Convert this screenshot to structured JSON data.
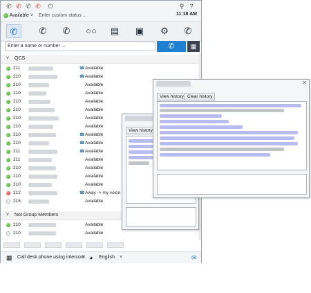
{
  "header": {
    "status_label": "Available",
    "custom_status_placeholder": "Enter custom status ...",
    "time": "11:18 AM"
  },
  "search": {
    "placeholder": "Enter a name or number ..."
  },
  "groups": [
    {
      "name": "QCS"
    },
    {
      "name": "Not Group Members"
    }
  ],
  "qcs_rows": [
    {
      "ext": "211",
      "status": "Available",
      "state": "green",
      "phone": true
    },
    {
      "ext": "210",
      "status": "Available",
      "state": "green",
      "phone": true
    },
    {
      "ext": "210",
      "status": "Available",
      "state": "green",
      "phone": false
    },
    {
      "ext": "210",
      "status": "Available",
      "state": "green",
      "phone": false
    },
    {
      "ext": "210",
      "status": "Available",
      "state": "green",
      "phone": false
    },
    {
      "ext": "210",
      "status": "Available",
      "state": "green",
      "phone": false
    },
    {
      "ext": "210",
      "status": "Available",
      "state": "green",
      "phone": false
    },
    {
      "ext": "210",
      "status": "Available",
      "state": "green",
      "phone": false
    },
    {
      "ext": "210",
      "status": "Available",
      "state": "green",
      "phone": true
    },
    {
      "ext": "210",
      "status": "Available",
      "state": "green",
      "phone": true
    },
    {
      "ext": "211",
      "status": "Available",
      "state": "green",
      "phone": true
    },
    {
      "ext": "211",
      "status": "Available",
      "state": "green",
      "phone": false
    },
    {
      "ext": "210",
      "status": "Available",
      "state": "green",
      "phone": false
    },
    {
      "ext": "210",
      "status": "Available",
      "state": "green",
      "phone": false
    },
    {
      "ext": "210",
      "status": "Available",
      "state": "green",
      "phone": false
    },
    {
      "ext": "212",
      "status": "Away -> my voice m",
      "state": "red",
      "phone": true
    },
    {
      "ext": "215",
      "status": "Available",
      "state": "empty",
      "phone": false
    }
  ],
  "other_rows": [
    {
      "ext": "210",
      "status": "Available",
      "state": "green"
    },
    {
      "ext": "210",
      "status": "Available",
      "state": "empty"
    }
  ],
  "footer": {
    "phone_label": "Call desk phone using intercom",
    "language": "English"
  },
  "chat_back": {
    "view_history": "View history"
  },
  "chat_front": {
    "view_history": "View history",
    "clear_history": "Clear history"
  }
}
